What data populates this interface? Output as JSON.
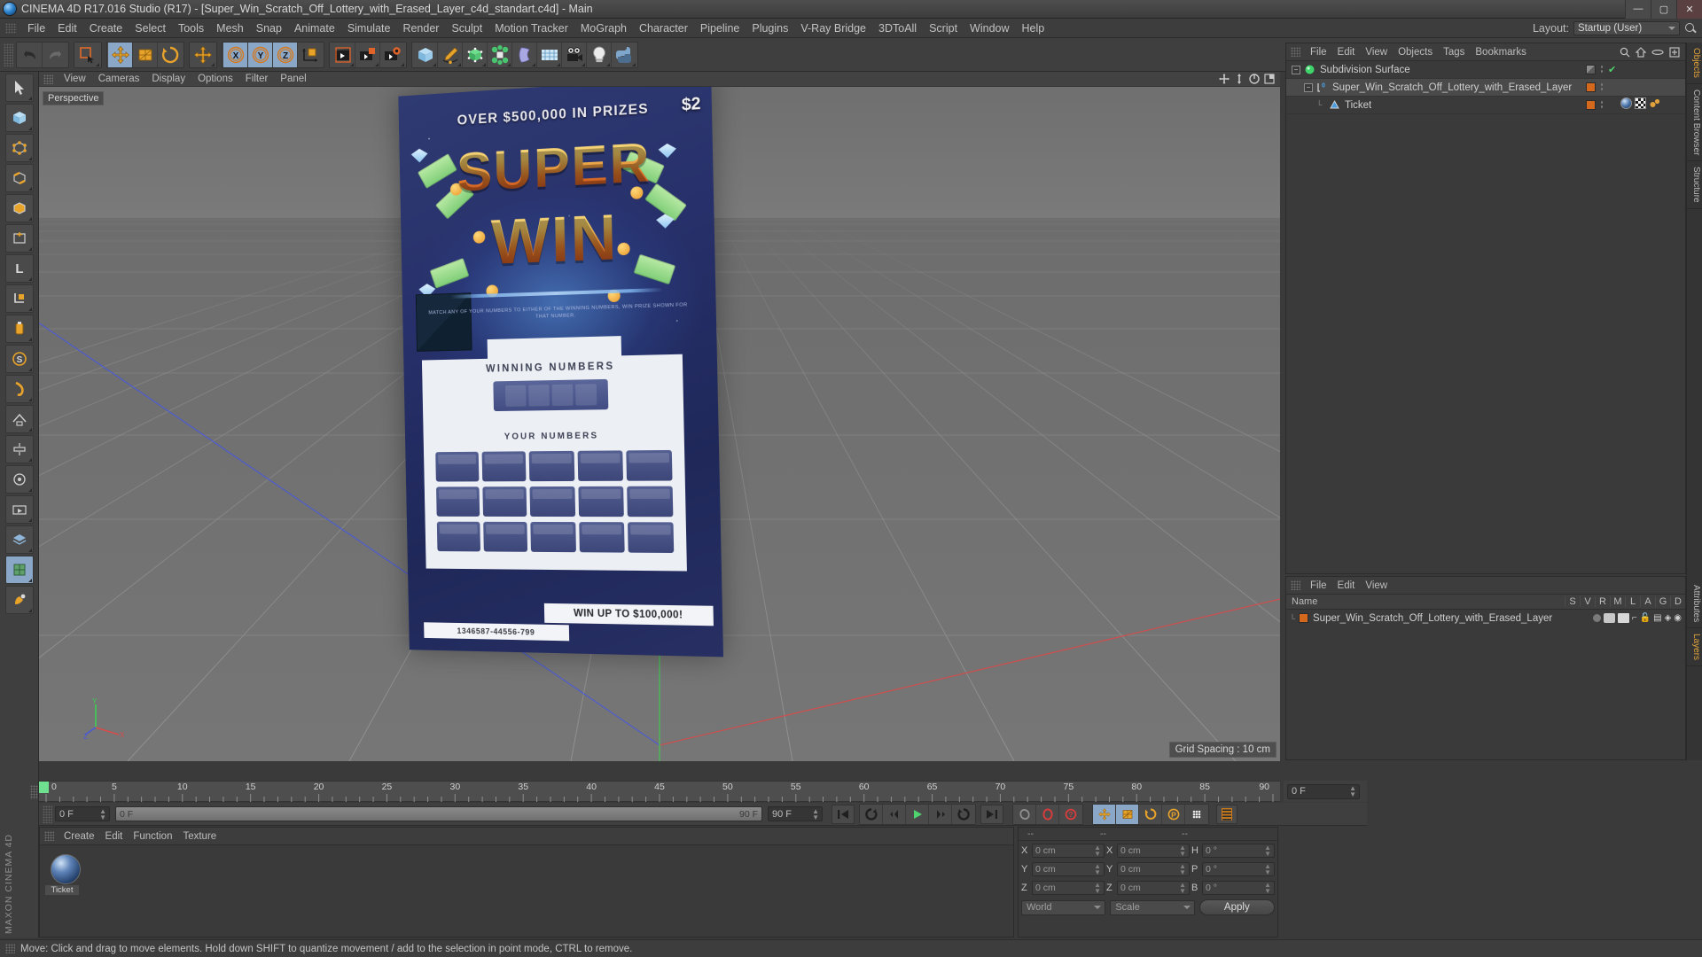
{
  "titlebar": {
    "text": "CINEMA 4D R17.016 Studio (R17) - [Super_Win_Scratch_Off_Lottery_with_Erased_Layer_c4d_standart.c4d] - Main",
    "minimize": "—",
    "maximize": "▢",
    "close": "✕"
  },
  "menubar": {
    "items": [
      "File",
      "Edit",
      "Create",
      "Select",
      "Tools",
      "Mesh",
      "Snap",
      "Animate",
      "Simulate",
      "Render",
      "Sculpt",
      "Motion Tracker",
      "MoGraph",
      "Character",
      "Pipeline",
      "Plugins",
      "V-Ray Bridge",
      "3DToAll",
      "Script",
      "Window",
      "Help"
    ],
    "layout_label": "Layout:",
    "layout_value": "Startup (User)"
  },
  "toolbar": {
    "groups": [
      {
        "name": "history",
        "buttons": [
          {
            "name": "undo-button",
            "icon": "undo"
          },
          {
            "name": "redo-button",
            "icon": "redo"
          }
        ]
      },
      {
        "name": "selection",
        "buttons": [
          {
            "name": "live-selection-button",
            "icon": "live-selection"
          }
        ]
      },
      {
        "name": "transform",
        "buttons": [
          {
            "name": "move-tool-button",
            "icon": "move",
            "active": true
          },
          {
            "name": "scale-tool-button",
            "icon": "scale"
          },
          {
            "name": "rotate-tool-button",
            "icon": "rotate"
          }
        ]
      },
      {
        "name": "move-group",
        "buttons": [
          {
            "name": "move-alt-button",
            "icon": "move"
          }
        ]
      },
      {
        "name": "axis-lock",
        "buttons": [
          {
            "name": "lock-x-axis-button",
            "icon": "axis-x",
            "active": true
          },
          {
            "name": "lock-y-axis-button",
            "icon": "axis-y",
            "active": true
          },
          {
            "name": "lock-z-axis-button",
            "icon": "axis-z",
            "active": true
          },
          {
            "name": "world-coordinate-button",
            "icon": "world-axis"
          }
        ]
      },
      {
        "name": "render",
        "buttons": [
          {
            "name": "render-view-button",
            "icon": "render-view"
          },
          {
            "name": "render-region-button",
            "icon": "render-region"
          },
          {
            "name": "render-settings-button",
            "icon": "render-settings"
          }
        ]
      },
      {
        "name": "primitives",
        "buttons": [
          {
            "name": "cube-primitive-button",
            "icon": "cube"
          },
          {
            "name": "spline-pen-button",
            "icon": "pen"
          },
          {
            "name": "generator-button",
            "icon": "generator"
          },
          {
            "name": "deformer-button",
            "icon": "deformer"
          },
          {
            "name": "bend-button",
            "icon": "bend"
          },
          {
            "name": "environment-button",
            "icon": "floor"
          },
          {
            "name": "camera-button",
            "icon": "camera"
          },
          {
            "name": "light-button",
            "icon": "light"
          },
          {
            "name": "python-button",
            "icon": "python"
          }
        ]
      }
    ]
  },
  "viewport": {
    "menu": [
      "View",
      "Cameras",
      "Display",
      "Options",
      "Filter",
      "Panel"
    ],
    "label": "Perspective",
    "grid_spacing": "Grid Spacing : 10 cm",
    "nav_icons": [
      "pan-icon",
      "dolly-icon",
      "orbit-icon",
      "maximize-icon"
    ]
  },
  "ticket": {
    "headline": "OVER $500,000 IN PRIZES",
    "price": "$2",
    "title_line1": "SUPER",
    "title_line2": "WIN",
    "fine_print": "MATCH ANY OF YOUR NUMBERS TO EITHER OF THE WINNING NUMBERS, WIN PRIZE SHOWN FOR THAT NUMBER.",
    "winning_numbers_label": "WINNING NUMBERS",
    "your_numbers_label": "YOUR NUMBERS",
    "win_up_to": "WIN UP TO $100,000!",
    "serial": "1346587-44556-799"
  },
  "object_manager": {
    "menu": [
      "File",
      "Edit",
      "View",
      "Objects",
      "Tags",
      "Bookmarks"
    ],
    "icons": [
      "search-icon",
      "home-icon",
      "ellipse-icon",
      "add-layer-icon"
    ],
    "objects": [
      {
        "name": "Subdivision Surface",
        "indent": 0,
        "icon": "subdivision-surface-icon",
        "swatch": "#6e6e6e",
        "check": true
      },
      {
        "name": "Super_Win_Scratch_Off_Lottery_with_Erased_Layer",
        "indent": 1,
        "icon": "null-object-icon",
        "swatch": "#d4691e",
        "check": false
      },
      {
        "name": "Ticket",
        "indent": 2,
        "icon": "polygon-object-icon",
        "swatch": "#d4691e",
        "check": false,
        "tags": [
          "material-tag-icon",
          "uvw-tag-icon",
          "phong-tag-icon"
        ]
      }
    ]
  },
  "layer_manager": {
    "menu": [
      "File",
      "Edit",
      "View"
    ],
    "columns": [
      "Name",
      "S",
      "V",
      "R",
      "M",
      "L",
      "A",
      "G",
      "D"
    ],
    "rows": [
      {
        "name": "Super_Win_Scratch_Off_Lottery_with_Erased_Layer",
        "swatch": "#d4691e"
      }
    ]
  },
  "right_tabs": {
    "top": [
      "Objects",
      "Content Browser",
      "Structure"
    ],
    "bottom": [
      "Attributes",
      "Layers"
    ]
  },
  "timeline": {
    "ticks": [
      "0",
      "5",
      "10",
      "15",
      "20",
      "25",
      "30",
      "35",
      "40",
      "45",
      "50",
      "55",
      "60",
      "65",
      "70",
      "75",
      "80",
      "85",
      "90"
    ],
    "current_frame_right": "0 F"
  },
  "playbar": {
    "start_frame": "0 F",
    "current_frame": "0 F",
    "end_frame_track": "90 F",
    "end_frame": "90 F",
    "buttons": [
      {
        "name": "go-to-start-button",
        "icon": "skip-start"
      },
      {
        "name": "play-reverse-button",
        "icon": "rewind-loop"
      },
      {
        "name": "previous-frame-button",
        "icon": "step-back"
      },
      {
        "name": "play-button",
        "icon": "play"
      },
      {
        "name": "next-frame-button",
        "icon": "step-forward"
      },
      {
        "name": "play-forward-loop-button",
        "icon": "loop"
      },
      {
        "name": "go-to-end-button",
        "icon": "skip-end"
      },
      {
        "name": "record-active-objects-button",
        "icon": "record-keyframe"
      },
      {
        "name": "autokeying-button",
        "icon": "autokey"
      },
      {
        "name": "keyframe-selection-button",
        "icon": "key-selection"
      },
      {
        "name": "position-key-button",
        "icon": "position-key"
      },
      {
        "name": "scale-key-button",
        "icon": "scale-key"
      },
      {
        "name": "rotation-key-button",
        "icon": "rotation-key"
      },
      {
        "name": "parameter-key-button",
        "icon": "param-key"
      },
      {
        "name": "point-level-animation-button",
        "icon": "pla-dots"
      },
      {
        "name": "timeline-toggle-button",
        "icon": "timeline-strip"
      }
    ]
  },
  "material_manager": {
    "menu": [
      "Create",
      "Edit",
      "Function",
      "Texture"
    ],
    "materials": [
      {
        "name": "Ticket",
        "preview": "sphere-preview"
      }
    ]
  },
  "coordinates": {
    "headers": [
      "--",
      "--",
      "--"
    ],
    "rows": [
      {
        "label1": "X",
        "value1": "0 cm",
        "label2": "X",
        "value2": "0 cm",
        "label3": "H",
        "value3": "0 °"
      },
      {
        "label1": "Y",
        "value1": "0 cm",
        "label2": "Y",
        "value2": "0 cm",
        "label3": "P",
        "value3": "0 °"
      },
      {
        "label1": "Z",
        "value1": "0 cm",
        "label2": "Z",
        "value2": "0 cm",
        "label3": "B",
        "value3": "0 °"
      }
    ],
    "system": "World",
    "mode": "Scale",
    "apply": "Apply"
  },
  "left_tools": [
    {
      "name": "tool-selection",
      "icon": "cursor"
    },
    {
      "name": "tool-cube-mode",
      "icon": "cube-mode"
    },
    {
      "name": "tool-point-mode",
      "icon": "point-mode"
    },
    {
      "name": "tool-edge-mode",
      "icon": "edge-mode"
    },
    {
      "name": "tool-polygon-mode",
      "icon": "poly-mode"
    },
    {
      "name": "tool-model-mode",
      "icon": "model-mode"
    },
    {
      "name": "tool-object-axis",
      "icon": "object-axis"
    },
    {
      "name": "tool-texture-axis",
      "icon": "texture-axis"
    },
    {
      "name": "tool-enable-axis",
      "icon": "enable-axis"
    },
    {
      "name": "tool-lock-axis",
      "icon": "lock-axis"
    },
    {
      "name": "tool-snap",
      "icon": "snap-magnet"
    },
    {
      "name": "tool-workplane",
      "icon": "workplane"
    },
    {
      "name": "tool-quantize",
      "icon": "quantize"
    },
    {
      "name": "tool-viewport-solo",
      "icon": "viewport-solo"
    },
    {
      "name": "tool-render-queue",
      "icon": "render-queue"
    },
    {
      "name": "tool-layer-browse",
      "icon": "layer-browse"
    },
    {
      "name": "tool-uv",
      "icon": "uv-tool"
    },
    {
      "name": "tool-paint",
      "icon": "paint-tool"
    }
  ],
  "brand": "MAXON CINEMA 4D",
  "statusbar": {
    "text": "Move: Click and drag to move elements. Hold down SHIFT to quantize movement / add to the selection in point mode, CTRL to remove."
  },
  "colors": {
    "accent_orange": "#e08a20",
    "active_blue": "#8aa7c8",
    "panel_bg": "#3a3a3a",
    "toolbar_bg": "#3f3f3f",
    "viewport_bg": "#6f6f6f",
    "green_axis": "#3ecf54",
    "red_axis": "#cf4040",
    "blue_axis": "#4050cf"
  }
}
